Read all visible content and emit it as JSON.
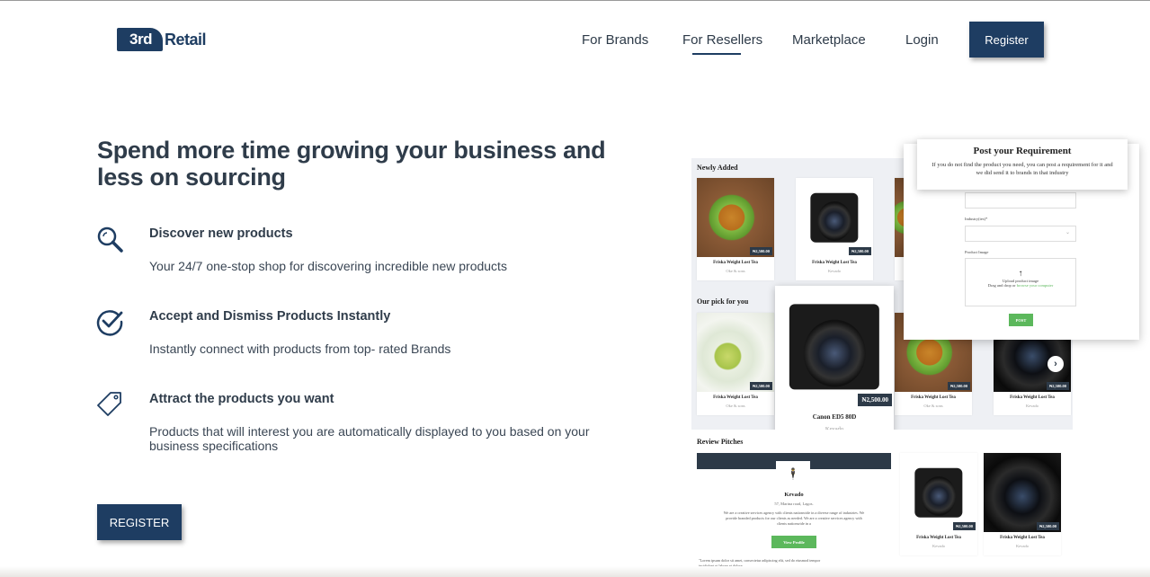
{
  "header": {
    "logo_badge": "3rd",
    "logo_text": "Retail",
    "nav": [
      "For Brands",
      "For Resellers",
      "Marketplace",
      "Login"
    ],
    "register_label": "Register"
  },
  "hero": {
    "title": "Spend more time growing your business and less on sourcing",
    "features": [
      {
        "title": "Discover new products",
        "desc": "Your 24/7 one-stop shop for discovering incredible new products",
        "icon": "search-icon"
      },
      {
        "title": "Accept and Dismiss Products Instantly",
        "desc": "Instantly connect with products from top- rated Brands",
        "icon": "check-circle-icon"
      },
      {
        "title": "Attract the products you want",
        "desc": "Products that will interest you are automatically displayed to you based on your business specifications",
        "icon": "tag-icon"
      }
    ],
    "cta_label": "REGISTER"
  },
  "mockup": {
    "newly_added_label": "Newly Added",
    "our_pick_label": "Our pick for you",
    "review_pitches_label": "Review Pitches",
    "price": "₦2,500.00",
    "product_name": "Friska Weight Lost Tea",
    "cards_row1": [
      {
        "sub": "Oke & sons"
      },
      {
        "sub": "Kevado"
      }
    ],
    "cards_row2": [
      {
        "sub": "Oke & sons"
      },
      {
        "sub": "Oke & sons"
      },
      {
        "sub": "Kevado"
      }
    ],
    "featured": {
      "price": "₦2,500.00",
      "name": "Canon ED5 80D",
      "sub": "Kevado"
    },
    "pitch": {
      "name": "Kevado",
      "address": "57, Marina road, Lagos.",
      "desc": "We are a creative services agency with clients nationwide in a diverse range of industries. We provide branded products for our clients as needed. We are a creative services agency with clients nationwide in a",
      "view_label": "View Profile",
      "quote": "\"Lorem ipsum dolor sit amet, consectetur adipiscing elit, sed do eiusmod tempor incididunt ut labore et dolore"
    },
    "pitch_cards": [
      {
        "sub": "Kevado"
      },
      {
        "sub": "Kevado"
      }
    ],
    "requirement": {
      "title": "Post your Requirement",
      "desc": "If you do not find the product you need, you can post a requirement for it and we did send it to brands in that industry",
      "industry_label": "Industry(ies)*",
      "image_label": "Product Image",
      "upload_title": "Upload product image",
      "upload_hint": "Drag and drop or",
      "upload_link": "browse your computer",
      "post_label": "POST"
    }
  },
  "colors": {
    "brand": "#1e3d62",
    "accent_green": "#5cb85c",
    "text": "#2d3a48"
  }
}
